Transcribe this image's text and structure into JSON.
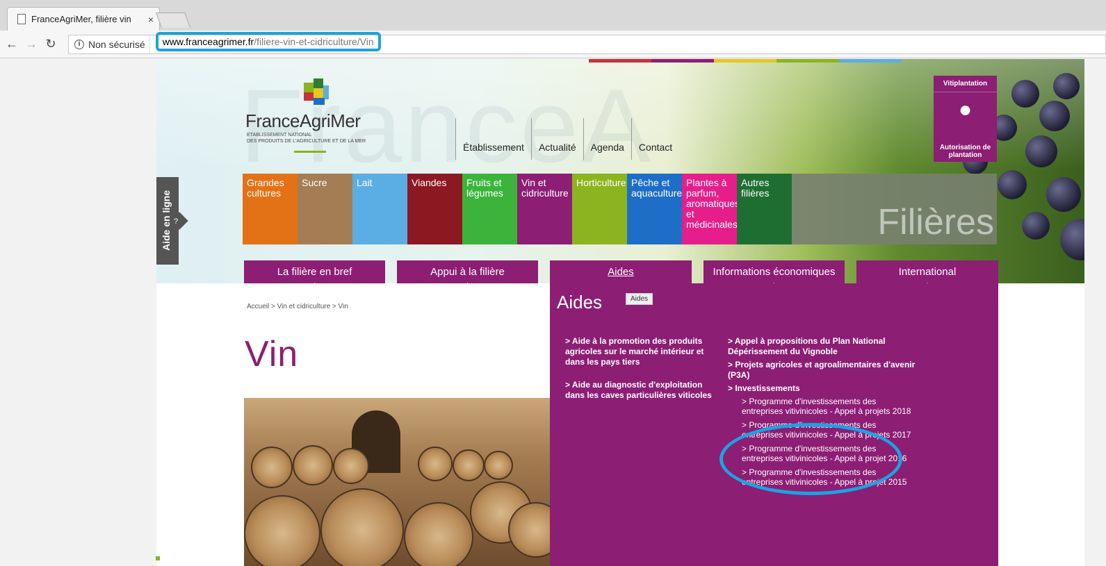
{
  "browser": {
    "tab_title": "FranceAgriMer, filière vin",
    "tab_close": "×",
    "security_label": "Non sécurisé",
    "url_host": "www.franceagrimer.fr",
    "url_path": "/filiere-vin-et-cidriculture/Vin"
  },
  "header": {
    "logo_name": "FranceAgriMer",
    "logo_sub1": "ETABLISSEMENT NATIONAL",
    "logo_sub2": "DES PRODUITS DE L'AGRICULTURE ET DE LA MER",
    "nav": [
      "Établissement",
      "Actualité",
      "Agenda",
      "Contact"
    ],
    "vitiplantation": {
      "title": "Vitiplantation",
      "footer": "Autorisation de plantation"
    }
  },
  "sectors": [
    {
      "label": "Grandes cultures",
      "color": "#e37216"
    },
    {
      "label": "Sucre",
      "color": "#a57d54"
    },
    {
      "label": "Lait",
      "color": "#5aaee2"
    },
    {
      "label": "Viandes",
      "color": "#8c1822"
    },
    {
      "label": "Fruits et légumes",
      "color": "#3cb43c"
    },
    {
      "label": "Vin et cidriculture",
      "color": "#8c1e74"
    },
    {
      "label": "Horticulture",
      "color": "#8cb41e"
    },
    {
      "label": "Pêche et aquaculture",
      "color": "#1e6ec8"
    },
    {
      "label": "Plantes à parfum, aromatiques et médicinales",
      "color": "#e61e8c"
    },
    {
      "label": "Autres filières",
      "color": "#1e6e32"
    }
  ],
  "filieres_label": "Filières",
  "aide_en_ligne": "Aide en ligne",
  "aide_q": "?",
  "tabs": [
    {
      "label": "La filière en bref",
      "plus": "+"
    },
    {
      "label": "Appui à la filière",
      "plus": "+"
    },
    {
      "label": "Aides",
      "plus": ""
    },
    {
      "label": "Informations économiques",
      "plus": "+"
    },
    {
      "label": "International",
      "plus": "+"
    }
  ],
  "breadcrumb": "Accueil > Vin et cidriculture > Vin",
  "page_title": "Vin",
  "aides_panel": {
    "title": "Aides",
    "chip": "Aides",
    "col1": [
      "> Aide à la promotion des produits agricoles sur le marché intérieur et dans les pays tiers",
      "> Aide au diagnostic d'exploitation dans les caves particulières viticoles"
    ],
    "col2": [
      "> Appel à propositions du Plan National Dépérissement du Vignoble",
      "> Projets agricoles et agroalimentaires d'avenir (P3A)",
      "> Investissements"
    ],
    "col2_sub": [
      "> Programme d'investissements des entreprises vitivinicoles - Appel à projets 2018",
      "> Programme d'investissements des entreprises vitivinicoles - Appel à projets 2017",
      "> Programme d'investissements des entreprises vitivinicoles - Appel à projet 2016",
      "> Programme d'investissements des entreprises vitivinicoles - Appel à projet 2015"
    ]
  },
  "icons": {
    "back": "arrow-left-icon",
    "forward": "arrow-right-icon",
    "reload": "reload-icon",
    "info": "info-icon"
  }
}
